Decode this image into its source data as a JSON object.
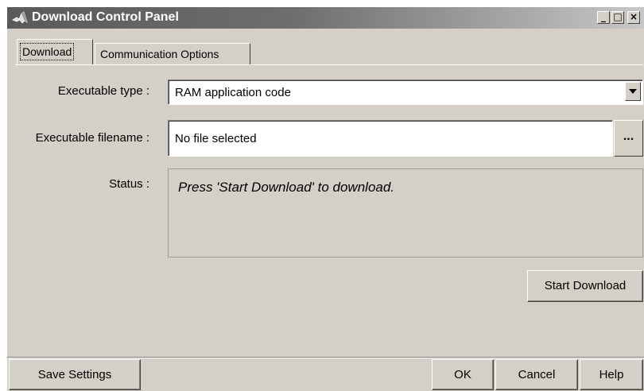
{
  "window": {
    "title": "Download Control Panel",
    "controls": {
      "minimize": "_",
      "maximize": "□",
      "close": "×"
    }
  },
  "tabs": [
    {
      "label": "Download",
      "active": true
    },
    {
      "label": "Communication Options",
      "active": false
    }
  ],
  "form": {
    "executable_type": {
      "label": "Executable type :",
      "value": "RAM application code"
    },
    "executable_filename": {
      "label": "Executable filename :",
      "value": "No file selected",
      "browse_label": "..."
    },
    "status": {
      "label": "Status :",
      "value": "Press 'Start Download' to download."
    }
  },
  "buttons": {
    "start_download": "Start Download",
    "save_settings": "Save Settings",
    "ok": "OK",
    "cancel": "Cancel",
    "help": "Help"
  },
  "icons": {
    "app": "matlab-logo-icon",
    "dropdown": "chevron-down-icon"
  }
}
